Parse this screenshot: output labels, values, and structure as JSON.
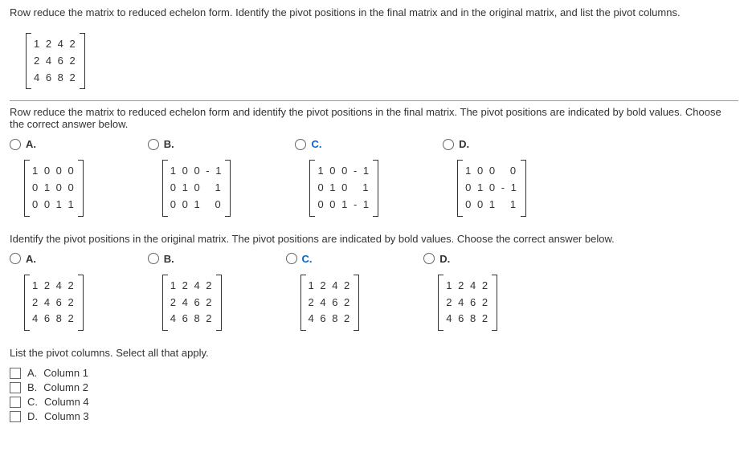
{
  "q1_text": "Row reduce the matrix to reduced echelon form. Identify the pivot positions in the final matrix and in the original matrix, and list the pivot columns.",
  "main_matrix": {
    "r1": "1 2 4 2",
    "r2": "2 4 6 2",
    "r3": "4 6 8 2"
  },
  "q2_text": "Row reduce the matrix to reduced echelon form and identify the pivot positions in the final matrix. The pivot positions are indicated by bold values. Choose the correct answer below.",
  "final_matrix_options": {
    "A": {
      "label": "A.",
      "r1": "1 0 0 0",
      "r2": "0 1 0 0",
      "r3": "0 0 1 1"
    },
    "B": {
      "label": "B.",
      "r1": "1 0 0 - 1",
      "r2": "0 1 0   1",
      "r3": "0 0 1   0"
    },
    "C": {
      "label": "C.",
      "r1": "1 0 0 - 1",
      "r2": "0 1 0   1",
      "r3": "0 0 1 - 1"
    },
    "D": {
      "label": "D.",
      "r1": "1 0 0   0",
      "r2": "0 1 0 - 1",
      "r3": "0 0 1   1"
    }
  },
  "q3_text": "Identify the pivot positions in the original matrix. The pivot positions are indicated by bold values. Choose the correct answer below.",
  "orig_matrix_options": {
    "A": {
      "label": "A.",
      "r1": "1 2 4 2",
      "r2": "2 4 6 2",
      "r3": "4 6 8 2"
    },
    "B": {
      "label": "B.",
      "r1": "1 2 4 2",
      "r2": "2 4 6 2",
      "r3": "4 6 8 2"
    },
    "C": {
      "label": "C.",
      "r1": "1 2 4 2",
      "r2": "2 4 6 2",
      "r3": "4 6 8 2"
    },
    "D": {
      "label": "D.",
      "r1": "1 2 4 2",
      "r2": "2 4 6 2",
      "r3": "4 6 8 2"
    }
  },
  "q4_text": "List the pivot columns. Select all that apply.",
  "checkbox_options": {
    "A": {
      "label": "A.",
      "text": "Column 1"
    },
    "B": {
      "label": "B.",
      "text": "Column 2"
    },
    "C": {
      "label": "C.",
      "text": "Column 4"
    },
    "D": {
      "label": "D.",
      "text": "Column 3"
    }
  }
}
